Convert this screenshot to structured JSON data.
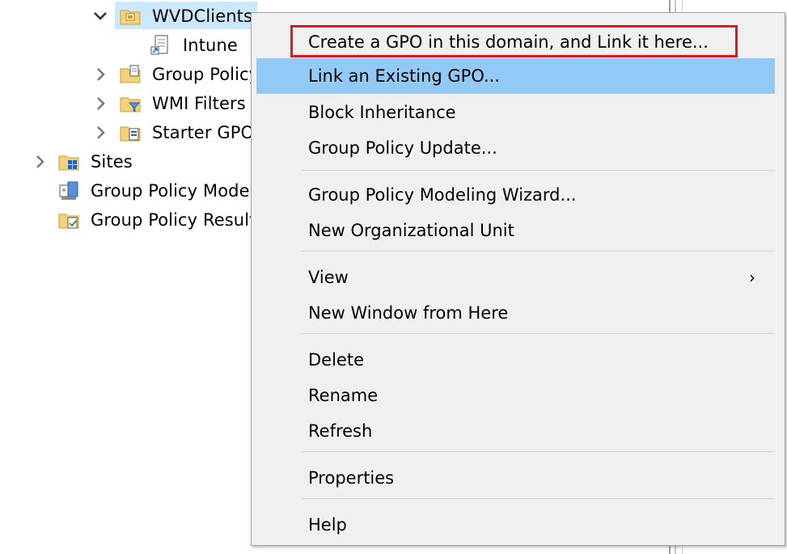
{
  "tree": {
    "items": [
      {
        "label": "WVDClients",
        "icon": "ou-folder-icon",
        "expanded": true,
        "selected": true
      },
      {
        "label": "Intune",
        "icon": "gpo-link-icon"
      },
      {
        "label": "Group Policy",
        "icon": "gpo-folder-icon"
      },
      {
        "label": "WMI Filters",
        "icon": "wmi-folder-icon"
      },
      {
        "label": "Starter GPOs",
        "icon": "starter-gpo-folder-icon"
      },
      {
        "label": "Sites",
        "icon": "sites-folder-icon"
      },
      {
        "label": "Group Policy Modeling",
        "icon": "modeling-icon"
      },
      {
        "label": "Group Policy Results",
        "icon": "results-folder-icon"
      }
    ]
  },
  "menu": {
    "items": [
      {
        "label": "Create a GPO in this domain, and Link it here...",
        "annotated": true
      },
      {
        "label": "Link an Existing GPO...",
        "highlighted": true
      },
      {
        "label": "Block Inheritance"
      },
      {
        "label": "Group Policy Update..."
      },
      {
        "label": "Group Policy Modeling Wizard..."
      },
      {
        "label": "New Organizational Unit"
      },
      {
        "label": "View",
        "submenu": true
      },
      {
        "label": "New Window from Here"
      },
      {
        "label": "Delete"
      },
      {
        "label": "Rename"
      },
      {
        "label": "Refresh"
      },
      {
        "label": "Properties"
      },
      {
        "label": "Help"
      }
    ],
    "submenu_glyph": "›"
  },
  "colors": {
    "highlight": "#91c9f7",
    "selection": "#cce8ff",
    "annotation": "#e3161e",
    "menu_bg": "#f0f0f0"
  }
}
